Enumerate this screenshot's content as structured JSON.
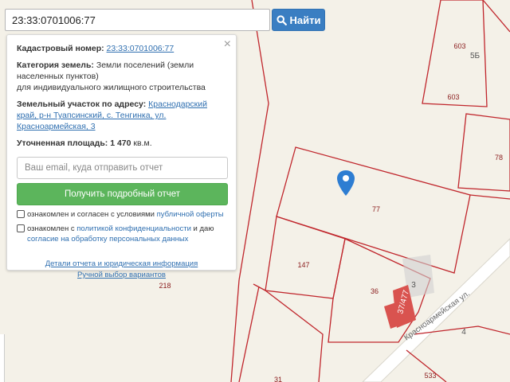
{
  "search": {
    "value": "23:33:0701006:77",
    "button_label": "Найти"
  },
  "card": {
    "cadastral_label": "Кадастровый номер:",
    "cadastral_value": "23:33:0701006:77",
    "category_label": "Категория земель:",
    "category_value": "Земли поселений (земли населенных пунктов)",
    "usage": "для индивидуального жилищного строительства",
    "address_label": "Земельный участок по адресу:",
    "address_value": "Краснодарский край, р-н Туапсинский, с. Тенгинка, ул. Красноармейская, 3",
    "area_label": "Уточненная площадь:",
    "area_value": "1 470",
    "area_unit": "кв.м.",
    "close_glyph": "×",
    "email_placeholder": "Ваш email, куда отправить отчет",
    "report_button": "Получить подробный отчет",
    "agree1_text": "ознакомлен и согласен с условиями ",
    "agree1_link": "публичной оферты",
    "agree2_text": "ознакомлен с ",
    "agree2_link": "политикой конфиденциальности",
    "agree2_mid": " и даю ",
    "agree2_link2": "согласие на обработку персональных данных",
    "link_details": "Детали отчета и юридическая информация",
    "link_manual": "Ручной выбор вариантов"
  },
  "map": {
    "plot_labels": [
      "603",
      "5Б",
      "603",
      "78",
      "77",
      "147",
      "36",
      "218",
      "31",
      "533",
      "3",
      "4"
    ],
    "building_label": "37/477",
    "street_label": "Красноармейская ул.",
    "colors": {
      "background": "#f4f1e8",
      "parcel_line": "#c0262c",
      "building": "#d9534f",
      "marker": "#2d7dd2",
      "road": "#ffffff"
    }
  }
}
